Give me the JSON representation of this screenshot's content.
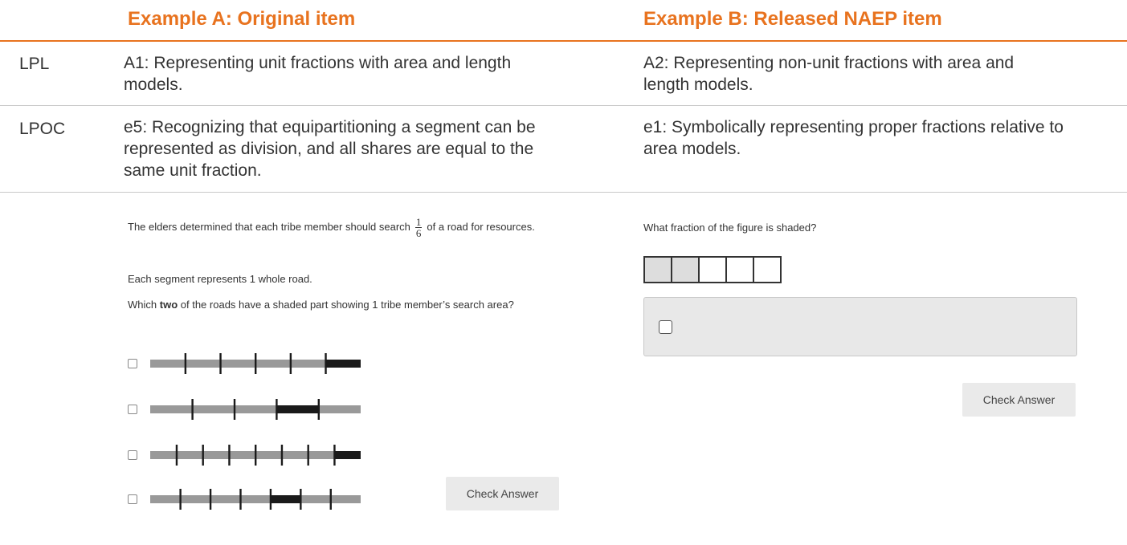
{
  "headers": {
    "col_a": "Example A: Original item",
    "col_b": "Example B: Released NAEP item"
  },
  "rows": [
    {
      "label": "LPL",
      "col_a": "A1: Representing unit fractions with area and length models.",
      "col_b": "A2: Representing non-unit fractions with area and length models."
    },
    {
      "label": "LPOC",
      "col_a": "e5: Recognizing that equipartitioning a segment can be represented as division, and all shares are equal to the same unit fraction.",
      "col_b": "e1: Symbolically representing proper fractions relative to area models."
    }
  ],
  "item_a": {
    "prompt_before": "The elders determined that each tribe member should search",
    "fraction_num": "1",
    "fraction_den": "6",
    "prompt_after": "of a road for resources.",
    "segment_note": "Each segment represents 1 whole road.",
    "question_pre": "Which",
    "question_bold": "two",
    "question_post": "of the roads have a shaded part showing 1 tribe member’s search area?",
    "roads": [
      {
        "parts": 6,
        "shaded_part": 6
      },
      {
        "parts": 5,
        "shaded_part": 4
      },
      {
        "parts": 8,
        "shaded_part": 8
      },
      {
        "parts": 7,
        "shaded_part": 5
      }
    ],
    "check_label": "Check Answer"
  },
  "item_b": {
    "question": "What fraction of the figure is shaded?",
    "figure": {
      "parts": 5,
      "shaded": 2
    },
    "check_label": "Check Answer"
  },
  "colors": {
    "accent": "#e8731f",
    "road_gray": "#999999",
    "road_dark": "#1a1a1a",
    "cell_shaded": "#dddddd"
  }
}
